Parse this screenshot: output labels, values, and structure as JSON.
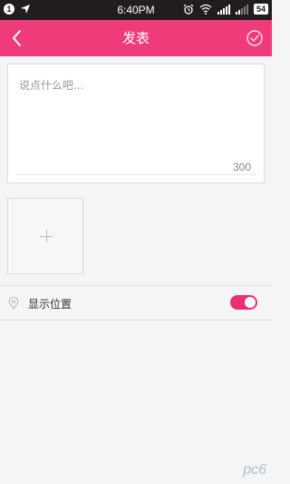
{
  "status_bar": {
    "notification_badge": "1",
    "time": "6:40PM",
    "battery": "54",
    "icons": [
      "location-arrow-icon",
      "alarm-icon",
      "wifi-icon",
      "signal-icon",
      "signal-icon"
    ]
  },
  "header": {
    "title": "发表",
    "accent_color": "#ef3b7a"
  },
  "composer": {
    "placeholder": "说点什么吧...",
    "char_count": "300"
  },
  "add_image": {
    "icon": "plus-icon"
  },
  "location": {
    "label": "显示位置",
    "enabled": true,
    "toggle_color": "#ee2e72"
  },
  "watermark": {
    "text": "pc6"
  }
}
